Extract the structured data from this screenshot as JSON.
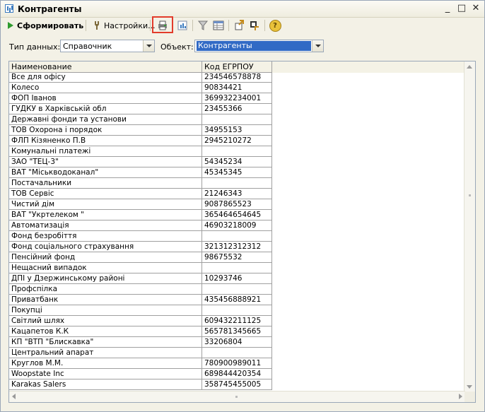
{
  "window": {
    "title": "Контрагенты",
    "minimize": "_",
    "maximize": "□",
    "close": "✕"
  },
  "toolbar": {
    "generate_label": "Сформировать",
    "settings_label": "Настройки...",
    "help_label": "?"
  },
  "filters": {
    "data_type_label": "Тип данных:",
    "data_type_value": "Справочник",
    "object_label": "Объект:",
    "object_value": "Контрагенты"
  },
  "table": {
    "columns": [
      "Наименование",
      "Код ЕГРПОУ"
    ],
    "rows": [
      [
        "Все для офісу",
        "234546578878"
      ],
      [
        "Колесо",
        "90834421"
      ],
      [
        "ФОП Іванов",
        "369932234001"
      ],
      [
        "ГУДКУ в Харківській обл",
        "23455366"
      ],
      [
        "Державні фонди та установи",
        ""
      ],
      [
        "ТОВ Охорона і порядок",
        "34955153"
      ],
      [
        "ФЛП Кізяненко П.В",
        "2945210272"
      ],
      [
        "Комунальні платежі",
        ""
      ],
      [
        "ЗАО \"ТЕЦ-3\"",
        "54345234"
      ],
      [
        "ВАТ \"Міськводоканал\"",
        "45345345"
      ],
      [
        "Постачальники",
        ""
      ],
      [
        "ТОВ  Сервіс",
        "21246343"
      ],
      [
        "Чистий дім",
        "9087865523"
      ],
      [
        "ВАТ \"Укртелеком \"",
        "365464654645"
      ],
      [
        "Автоматизація",
        "46903218009"
      ],
      [
        "Фонд безробіття",
        ""
      ],
      [
        "Фонд соціального страхування",
        "321312312312"
      ],
      [
        "Пенсійний фонд",
        "98675532"
      ],
      [
        "Нещасний випадок",
        ""
      ],
      [
        "ДПІ у Дзержинському районі",
        "10293746"
      ],
      [
        "Профспілка",
        ""
      ],
      [
        "Приватбанк",
        "435456888921"
      ],
      [
        "Покупці",
        ""
      ],
      [
        "Світлий шлях",
        "609432211125"
      ],
      [
        "Кацапетов К.К",
        "565781345665"
      ],
      [
        "КП \"ВТП \"Блискавка\"",
        "33206804"
      ],
      [
        "Центральний апарат",
        ""
      ],
      [
        "Круглов М.М.",
        "780900989011"
      ],
      [
        "Woopstate Inc",
        "689844420354"
      ],
      [
        "Karakas Salers",
        "358745455005"
      ]
    ]
  },
  "colors": {
    "highlight": "#e23b2b",
    "selection": "#316ac5",
    "play": "#2e9b2e"
  }
}
